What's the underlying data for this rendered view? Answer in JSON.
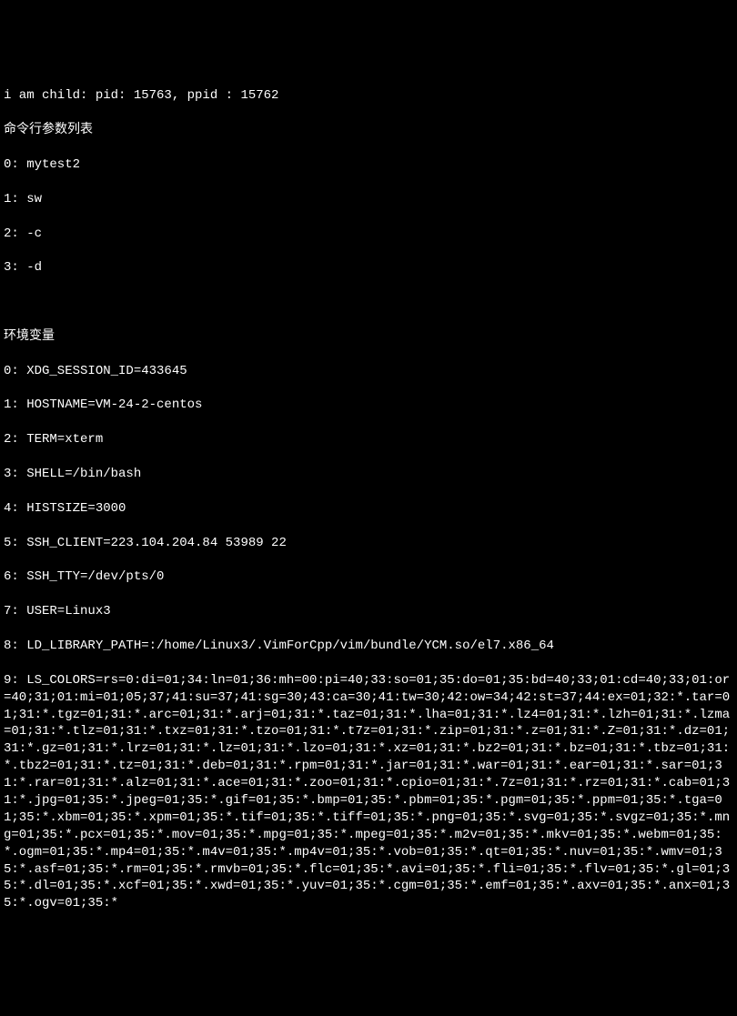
{
  "header": {
    "child_info": "i am child: pid: 15763, ppid : 15762",
    "args_title": "命令行参数列表",
    "args": [
      "0: mytest2",
      "1: sw",
      "2: -c",
      "3: -d"
    ],
    "env_title": "环境变量",
    "env_vars": [
      "0: XDG_SESSION_ID=433645",
      "1: HOSTNAME=VM-24-2-centos",
      "2: TERM=xterm",
      "3: SHELL=/bin/bash",
      "4: HISTSIZE=3000",
      "5: SSH_CLIENT=223.104.204.84 53989 22",
      "6: SSH_TTY=/dev/pts/0",
      "7: USER=Linux3",
      "8: LD_LIBRARY_PATH=:/home/Linux3/.VimForCpp/vim/bundle/YCM.so/el7.x86_64"
    ],
    "ls_colors": "9: LS_COLORS=rs=0:di=01;34:ln=01;36:mh=00:pi=40;33:so=01;35:do=01;35:bd=40;33;01:cd=40;33;01:or=40;31;01:mi=01;05;37;41:su=37;41:sg=30;43:ca=30;41:tw=30;42:ow=34;42:st=37;44:ex=01;32:*.tar=01;31:*.tgz=01;31:*.arc=01;31:*.arj=01;31:*.taz=01;31:*.lha=01;31:*.lz4=01;31:*.lzh=01;31:*.lzma=01;31:*.tlz=01;31:*.txz=01;31:*.tzo=01;31:*.t7z=01;31:*.zip=01;31:*.z=01;31:*.Z=01;31:*.dz=01;31:*.gz=01;31:*.lrz=01;31:*.lz=01;31:*.lzo=01;31:*.xz=01;31:*.bz2=01;31:*.bz=01;31:*.tbz=01;31:*.tbz2=01;31:*.tz=01;31:*.deb=01;31:*.rpm=01;31:*.jar=01;31:*.war=01;31:*.ear=01;31:*.sar=01;31:*.rar=01;31:*.alz=01;31:*.ace=01;31:*.zoo=01;31:*.cpio=01;31:*.7z=01;31:*.rz=01;31:*.cab=01;31:*.jpg=01;35:*.jpeg=01;35:*.gif=01;35:*.bmp=01;35:*.pbm=01;35:*.pgm=01;35:*.ppm=01;35:*.tga=01;35:*.xbm=01;35:*.xpm=01;35:*.tif=01;35:*.tiff=01;35:*.png=01;35:*.svg=01;35:*.svgz=01;35:*.mng=01;35:*.pcx=01;35:*.mov=01;35:*.mpg=01;35:*.mpeg=01;35:*.m2v=01;35:*.mkv=01;35:*.webm=01;35:*.ogm=01;35:*.mp4=01;35:*.m4v=01;35:*.mp4v=01;35:*.vob=01;35:*.qt=01;35:*.nuv=01;35:*.wmv=01;35:*.asf=01;35:*.rm=01;35:*.rmvb=01;35:*.flc=01;35:*.avi=01;35:*.fli=01;35:*.flv=01;35:*.gl=01;35:*.dl=01;35:*.xcf=01;35:*.xwd=01;35:*.yuv=01;35:*.cgm=01;35:*.emf=01;35:*.axv=01;35:*.anx=01;35:*.ogv=01;35:*"
  }
}
